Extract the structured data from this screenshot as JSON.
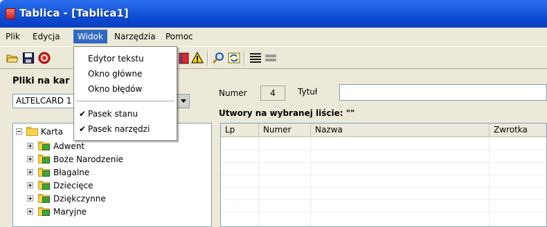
{
  "window": {
    "title": "Tablica - [Tablica1]"
  },
  "menu": [
    {
      "label": "Plik"
    },
    {
      "label": "Edycja"
    },
    {
      "label": "Widok"
    },
    {
      "label": "Narzędzia"
    },
    {
      "label": "Pomoc"
    }
  ],
  "view_menu": {
    "items": [
      "Edytor tekstu",
      "Okno główne",
      "Okno błędów"
    ],
    "checked_items": [
      "Pasek stanu",
      "Pasek narzędzi"
    ],
    "check_glyph": "✔"
  },
  "left": {
    "title": "Pliki na kar",
    "combo_value": "ALTELCARD 1",
    "tree_root": "Karta",
    "tree_items": [
      "Adwent",
      "Boże Narodzenie",
      "Błagalne",
      "Dziecięce",
      "Dziękczynne",
      "Maryjne"
    ]
  },
  "right": {
    "number_label": "Numer",
    "number_value": "4",
    "title_label": "Tytuł",
    "list_caption": "Utwory na wybranej liście: \"\"",
    "columns": [
      "Lp",
      "Numer",
      "Nazwa",
      "Zwrotka"
    ]
  },
  "colors": {
    "titlebar": "#0b48d0",
    "menu_highlight": "#316ac5",
    "folder": "#f7d34e",
    "folder_doc": "#3fa53a"
  },
  "toolbar_icons": [
    "open-folder-icon",
    "save-icon",
    "stop-icon",
    "book-icon",
    "warning-icon",
    "search-icon",
    "refresh-icon",
    "list-icon",
    "flat-list-icon"
  ]
}
